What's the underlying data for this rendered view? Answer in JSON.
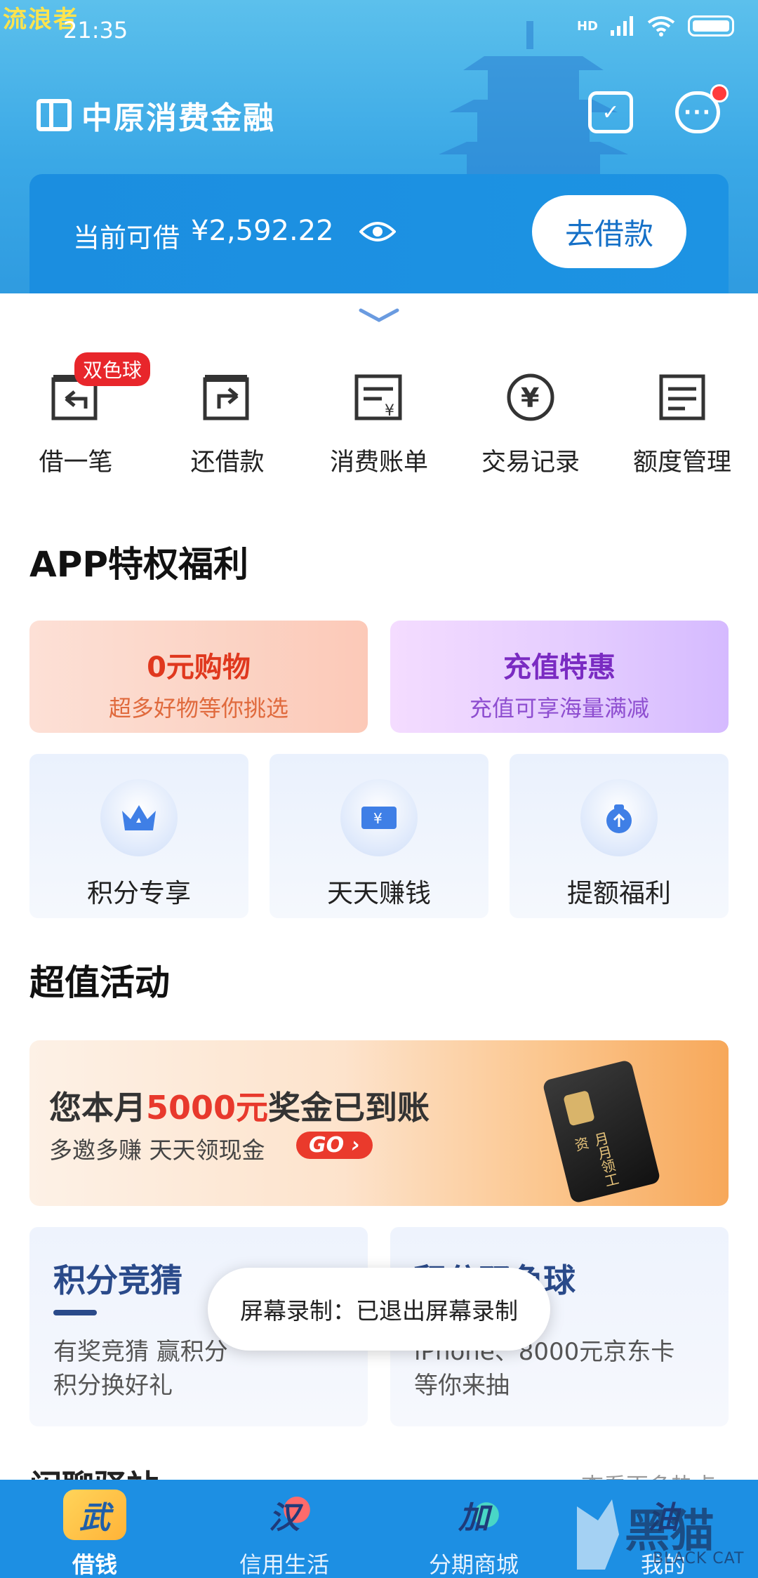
{
  "watermark_top": "流浪者",
  "status_bar": {
    "time": "21:35",
    "network": "HD"
  },
  "header": {
    "brand": "中原消费金融"
  },
  "borrow_card": {
    "label": "当前可借",
    "amount": "¥2,592.22",
    "button": "去借款"
  },
  "quick_actions": [
    {
      "label": "借一笔",
      "icon": "borrow-icon",
      "badge": "双色球"
    },
    {
      "label": "还借款",
      "icon": "repay-icon"
    },
    {
      "label": "消费账单",
      "icon": "bill-icon"
    },
    {
      "label": "交易记录",
      "icon": "yen-circle-icon"
    },
    {
      "label": "额度管理",
      "icon": "document-icon"
    }
  ],
  "section_privileges": {
    "title": "APP特权福利"
  },
  "promos": [
    {
      "title": "0元购物",
      "subtitle": "超多好物等你挑选"
    },
    {
      "title": "充值特惠",
      "subtitle": "充值可享海量满减"
    }
  ],
  "tiles": [
    {
      "label": "积分专享",
      "icon": "crown-icon"
    },
    {
      "label": "天天赚钱",
      "icon": "ticket-icon"
    },
    {
      "label": "提额福利",
      "icon": "money-bag-icon"
    }
  ],
  "section_activities": {
    "title": "超值活动"
  },
  "banner": {
    "line1_prefix": "您本月",
    "line1_highlight": "5000元",
    "line1_suffix": "奖金已到账",
    "line2": "多邀多赚 天天领现金",
    "go": "GO ›",
    "card_text": "月月领工资"
  },
  "games": [
    {
      "title": "积分竞猜",
      "line1": "有奖竞猜 赢积分",
      "line2": "积分换好礼"
    },
    {
      "title": "积分双色球",
      "line1": "iPhone、8000元京东卡",
      "line2": "等你来抽"
    }
  ],
  "toast": "屏幕录制：已退出屏幕录制",
  "partial_section": {
    "title": "闪聊驿站",
    "more": "查看更多热点"
  },
  "tabbar": [
    {
      "label": "借钱",
      "glyph": "武",
      "active": true
    },
    {
      "label": "信用生活",
      "glyph": "汉"
    },
    {
      "label": "分期商城",
      "glyph": "加"
    },
    {
      "label": "我的",
      "glyph": "油"
    }
  ],
  "watermark_bottom": {
    "text": "黑猫",
    "sub": "BLACK CAT"
  },
  "colors": {
    "brand_blue": "#1d8fe3",
    "accent_red": "#e8392c",
    "purple": "#7a2bc2"
  }
}
